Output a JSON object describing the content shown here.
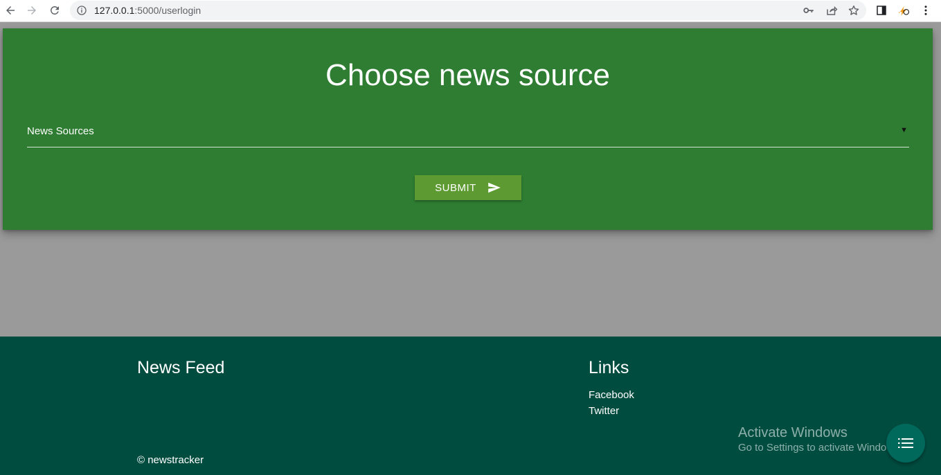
{
  "browser": {
    "url_host": "127.0.0.1",
    "url_path": ":5000/userlogin",
    "icons": [
      "back-arrow-icon",
      "forward-arrow-icon",
      "reload-icon",
      "info-icon",
      "key-icon",
      "share-icon",
      "star-icon",
      "side-panel-icon",
      "extension-icon",
      "more-menu-icon"
    ]
  },
  "form": {
    "title": "Choose news source",
    "select_value": "News Sources",
    "select_caret": "▼",
    "submit_label": "SUBMIT",
    "submit_icon": "send-icon",
    "colors": {
      "card_bg": "#2e7d32",
      "button_bg": "#5d9a32"
    }
  },
  "footer": {
    "news_title": "News Feed",
    "links_title": "Links",
    "links": [
      "Facebook",
      "Twitter"
    ],
    "copyright": "© newstracker",
    "bg_color": "#004d40"
  },
  "watermark": {
    "title": "Activate Windows",
    "subtitle": "Go to Settings to activate Windows."
  },
  "fab": {
    "icon": "list-icon",
    "color": "#00695c"
  }
}
